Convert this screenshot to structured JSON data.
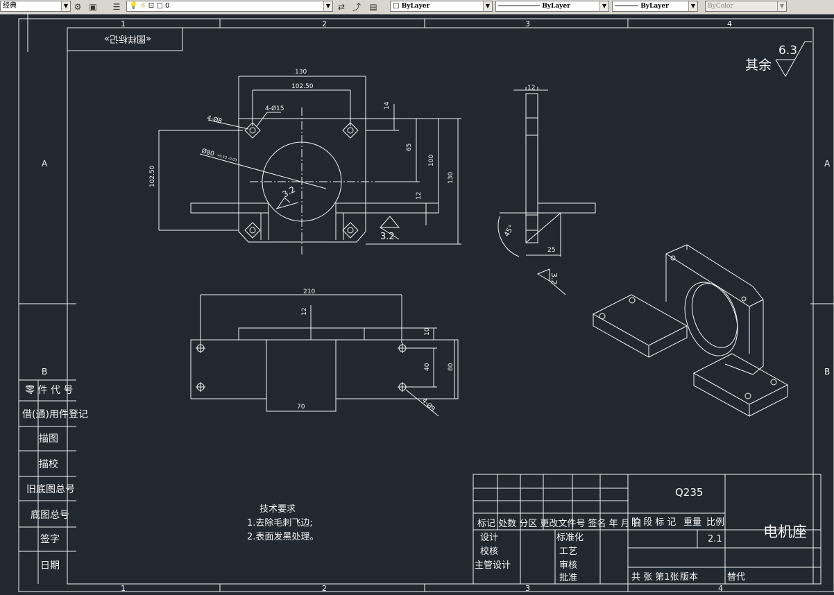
{
  "toolbar": {
    "workspace": "经典",
    "layer": "0",
    "color": "ByLayer",
    "linetype": "ByLayer",
    "lineweight": "ByLayer",
    "plotstyle": "ByColor"
  },
  "frame": {
    "col_1": "1",
    "col_2": "2",
    "col_3": "3",
    "col_4": "4",
    "row_a": "A",
    "row_b": "B"
  },
  "stamp": "«图样标记»",
  "roughness": {
    "label": "其余",
    "value": "6.3"
  },
  "front_view": {
    "dim_130": "130",
    "dim_102_50": "102.50",
    "dim_4_phi8": "4-Ø8",
    "dim_4_15": "4-Ø15",
    "dim_phi80": "Ø80",
    "dim_phi80_tol": "+0.15 -0.03",
    "dim_14": "14",
    "dim_65": "65",
    "dim_100": "100",
    "dim_130_v": "130",
    "dim_12": "12",
    "dim_102_50_v": "102.50",
    "rough_32_a": "3.2",
    "rough_32_b": "3.2"
  },
  "side_view": {
    "dim_12": "12",
    "dim_45": "45°",
    "dim_25": "25",
    "rough_32": "3.2"
  },
  "top_view": {
    "dim_210": "210",
    "dim_12": "12",
    "dim_10": "10",
    "dim_40": "40",
    "dim_80": "80",
    "dim_70": "70",
    "dim_4_phi9": "4-Ø9"
  },
  "tech_notes": {
    "title": "技术要求",
    "line1": "1.去除毛刺飞边;",
    "line2": "2.表面发黑处理。"
  },
  "left_table": [
    "零 件 代 号",
    "借(通)用件登记",
    "描图",
    "描校",
    "旧底图总号",
    "底图总号",
    "签字",
    "日期"
  ],
  "title_block": {
    "material": "Q235",
    "part_name": "电机座",
    "header_row": "标记 处数  分区  更改文件号 签名 年 月 日",
    "stage_row": "阶 段 标 记",
    "weight": "重量",
    "scale_label": "比例",
    "scale_value": "2.1",
    "design": "设计",
    "check": "校核",
    "chief": "主管设计",
    "standard": "标准化",
    "process": "工艺",
    "review": "审核",
    "approve": "批准",
    "total": "共  张  第1张",
    "version": "版本",
    "replace": "替代"
  }
}
